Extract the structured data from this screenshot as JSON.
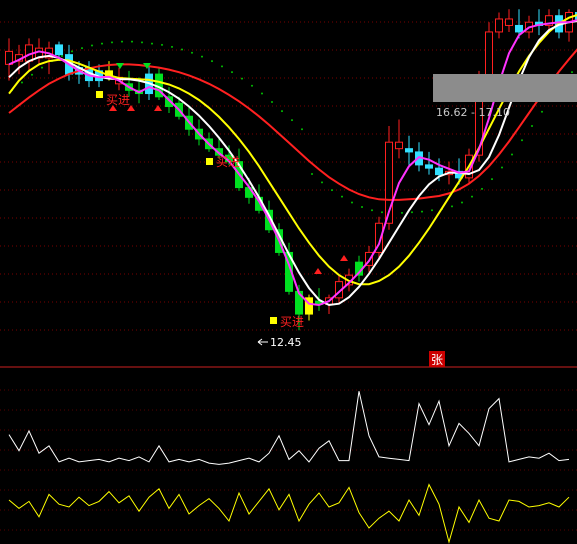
{
  "chart_data": {
    "type": "line",
    "background": "#000000",
    "grid": true,
    "annotations": {
      "buy_label": "买进",
      "low_price": "12.45",
      "range_label": "16.62 - 17.10",
      "zhang_label": "张"
    },
    "candles": [
      {
        "o": 16.55,
        "h": 16.95,
        "l": 16.3,
        "c": 16.75,
        "color": "red"
      },
      {
        "o": 16.7,
        "h": 16.85,
        "l": 16.4,
        "c": 16.6,
        "color": "red"
      },
      {
        "o": 16.6,
        "h": 16.95,
        "l": 16.45,
        "c": 16.85,
        "color": "red"
      },
      {
        "o": 16.8,
        "h": 16.95,
        "l": 16.55,
        "c": 16.65,
        "color": "red"
      },
      {
        "o": 16.65,
        "h": 16.9,
        "l": 16.4,
        "c": 16.8,
        "color": "red"
      },
      {
        "o": 16.85,
        "h": 16.9,
        "l": 16.65,
        "c": 16.7,
        "color": "cyan"
      },
      {
        "o": 16.7,
        "h": 16.85,
        "l": 16.3,
        "c": 16.4,
        "color": "cyan"
      },
      {
        "o": 16.4,
        "h": 16.6,
        "l": 16.25,
        "c": 16.5,
        "color": "cyan"
      },
      {
        "o": 16.5,
        "h": 16.6,
        "l": 16.2,
        "c": 16.3,
        "color": "cyan"
      },
      {
        "o": 16.3,
        "h": 16.55,
        "l": 16.2,
        "c": 16.45,
        "color": "cyan"
      },
      {
        "o": 16.45,
        "h": 16.6,
        "l": 16.3,
        "c": 16.35,
        "color": "yellow"
      },
      {
        "o": 16.35,
        "h": 16.5,
        "l": 16.15,
        "c": 16.25,
        "color": "red"
      },
      {
        "o": 16.25,
        "h": 16.45,
        "l": 16.05,
        "c": 16.15,
        "color": "green"
      },
      {
        "o": 16.15,
        "h": 16.35,
        "l": 15.95,
        "c": 16.1,
        "color": "green"
      },
      {
        "o": 16.1,
        "h": 16.55,
        "l": 16.0,
        "c": 16.4,
        "color": "cyan"
      },
      {
        "o": 16.4,
        "h": 16.5,
        "l": 16.0,
        "c": 16.05,
        "color": "green"
      },
      {
        "o": 16.05,
        "h": 16.2,
        "l": 15.8,
        "c": 15.9,
        "color": "green"
      },
      {
        "o": 15.95,
        "h": 16.05,
        "l": 15.7,
        "c": 15.75,
        "color": "green"
      },
      {
        "o": 15.75,
        "h": 15.9,
        "l": 15.45,
        "c": 15.55,
        "color": "green"
      },
      {
        "o": 15.55,
        "h": 15.7,
        "l": 15.3,
        "c": 15.4,
        "color": "green"
      },
      {
        "o": 15.4,
        "h": 15.5,
        "l": 15.2,
        "c": 15.25,
        "color": "green"
      },
      {
        "o": 15.25,
        "h": 15.4,
        "l": 15.1,
        "c": 15.15,
        "color": "green"
      },
      {
        "o": 15.15,
        "h": 15.3,
        "l": 15.0,
        "c": 15.05,
        "color": "green"
      },
      {
        "o": 15.05,
        "h": 15.25,
        "l": 14.6,
        "c": 14.65,
        "color": "green"
      },
      {
        "o": 14.65,
        "h": 14.8,
        "l": 14.4,
        "c": 14.5,
        "color": "green"
      },
      {
        "o": 14.5,
        "h": 14.7,
        "l": 14.25,
        "c": 14.3,
        "color": "green"
      },
      {
        "o": 14.3,
        "h": 14.45,
        "l": 13.95,
        "c": 14.0,
        "color": "green"
      },
      {
        "o": 14.0,
        "h": 14.1,
        "l": 13.6,
        "c": 13.65,
        "color": "green"
      },
      {
        "o": 13.65,
        "h": 13.8,
        "l": 13.0,
        "c": 13.05,
        "color": "green"
      },
      {
        "o": 13.05,
        "h": 13.15,
        "l": 12.45,
        "c": 12.7,
        "color": "green"
      },
      {
        "o": 12.7,
        "h": 13.0,
        "l": 12.6,
        "c": 12.95,
        "color": "yellow"
      },
      {
        "o": 12.9,
        "h": 13.1,
        "l": 12.75,
        "c": 12.85,
        "color": "green"
      },
      {
        "o": 12.85,
        "h": 13.0,
        "l": 12.7,
        "c": 12.95,
        "color": "red"
      },
      {
        "o": 12.95,
        "h": 13.3,
        "l": 12.85,
        "c": 13.2,
        "color": "red"
      },
      {
        "o": 13.15,
        "h": 13.4,
        "l": 13.05,
        "c": 13.3,
        "color": "red"
      },
      {
        "o": 13.3,
        "h": 13.6,
        "l": 13.2,
        "c": 13.5,
        "color": "green"
      },
      {
        "o": 13.45,
        "h": 13.75,
        "l": 13.35,
        "c": 13.65,
        "color": "red"
      },
      {
        "o": 13.65,
        "h": 14.2,
        "l": 13.55,
        "c": 14.1,
        "color": "red"
      },
      {
        "o": 14.1,
        "h": 15.6,
        "l": 14.0,
        "c": 15.35,
        "color": "red"
      },
      {
        "o": 15.35,
        "h": 15.7,
        "l": 15.1,
        "c": 15.25,
        "color": "red"
      },
      {
        "o": 15.25,
        "h": 15.45,
        "l": 15.0,
        "c": 15.2,
        "color": "cyan"
      },
      {
        "o": 15.2,
        "h": 15.35,
        "l": 14.9,
        "c": 15.0,
        "color": "cyan"
      },
      {
        "o": 15.0,
        "h": 15.2,
        "l": 14.85,
        "c": 14.95,
        "color": "cyan"
      },
      {
        "o": 14.95,
        "h": 15.1,
        "l": 14.75,
        "c": 14.85,
        "color": "cyan"
      },
      {
        "o": 14.85,
        "h": 15.05,
        "l": 14.7,
        "c": 14.9,
        "color": "red"
      },
      {
        "o": 14.9,
        "h": 15.1,
        "l": 14.7,
        "c": 14.8,
        "color": "cyan"
      },
      {
        "o": 14.8,
        "h": 15.25,
        "l": 14.7,
        "c": 15.15,
        "color": "red"
      },
      {
        "o": 15.15,
        "h": 16.45,
        "l": 15.05,
        "c": 16.3,
        "color": "red"
      },
      {
        "o": 16.3,
        "h": 17.2,
        "l": 16.2,
        "c": 17.05,
        "color": "red"
      },
      {
        "o": 17.05,
        "h": 17.35,
        "l": 16.95,
        "c": 17.25,
        "color": "red"
      },
      {
        "o": 17.25,
        "h": 17.4,
        "l": 17.05,
        "c": 17.15,
        "color": "red"
      },
      {
        "o": 17.15,
        "h": 17.4,
        "l": 16.95,
        "c": 17.05,
        "color": "cyan"
      },
      {
        "o": 17.05,
        "h": 17.3,
        "l": 16.95,
        "c": 17.2,
        "color": "red"
      },
      {
        "o": 17.2,
        "h": 17.4,
        "l": 17.0,
        "c": 17.15,
        "color": "cyan"
      },
      {
        "o": 17.15,
        "h": 17.4,
        "l": 17.05,
        "c": 17.3,
        "color": "red"
      },
      {
        "o": 17.3,
        "h": 17.4,
        "l": 16.95,
        "c": 17.05,
        "color": "cyan"
      },
      {
        "o": 17.05,
        "h": 17.4,
        "l": 16.9,
        "c": 17.35,
        "color": "red"
      },
      {
        "o": 17.35,
        "h": 17.4,
        "l": 17.1,
        "c": 17.25,
        "color": "cyan"
      }
    ],
    "lines": [
      {
        "color": "#ff2020",
        "values": [
          15.8,
          15.92,
          16.04,
          16.15,
          16.25,
          16.33,
          16.4,
          16.45,
          16.49,
          16.52,
          16.54,
          16.55,
          16.55,
          16.54,
          16.52,
          16.5,
          16.47,
          16.43,
          16.38,
          16.32,
          16.25,
          16.17,
          16.08,
          15.98,
          15.87,
          15.75,
          15.62,
          15.48,
          15.34,
          15.2,
          15.06,
          14.93,
          14.81,
          14.71,
          14.62,
          14.55,
          14.5,
          14.47,
          14.46,
          14.46,
          14.47,
          14.48,
          14.5,
          14.52,
          14.56,
          14.62,
          14.71,
          14.83,
          14.98,
          15.16,
          15.36,
          15.58,
          15.8,
          16.02,
          16.23,
          16.44,
          16.63,
          16.81,
          16.96
        ]
      },
      {
        "color": "#ffff00",
        "values": [
          16.1,
          16.3,
          16.45,
          16.55,
          16.6,
          16.62,
          16.61,
          16.56,
          16.5,
          16.44,
          16.38,
          16.34,
          16.33,
          16.32,
          16.31,
          16.28,
          16.24,
          16.18,
          16.1,
          16.0,
          15.88,
          15.74,
          15.58,
          15.4,
          15.2,
          14.98,
          14.74,
          14.5,
          14.26,
          14.02,
          13.8,
          13.6,
          13.43,
          13.3,
          13.21,
          13.16,
          13.16,
          13.21,
          13.3,
          13.43,
          13.6,
          13.8,
          14.02,
          14.26,
          14.5,
          14.74,
          14.98,
          15.26,
          15.56,
          15.86,
          16.16,
          16.44,
          16.68,
          16.88,
          17.05,
          17.18,
          17.27,
          17.32,
          17.34
        ]
      },
      {
        "color": "#ffffff",
        "values": [
          16.35,
          16.5,
          16.6,
          16.66,
          16.68,
          16.65,
          16.58,
          16.5,
          16.42,
          16.36,
          16.33,
          16.32,
          16.32,
          16.3,
          16.26,
          16.2,
          16.12,
          16.02,
          15.9,
          15.76,
          15.6,
          15.42,
          15.22,
          15.0,
          14.76,
          14.5,
          14.22,
          13.92,
          13.62,
          13.34,
          13.1,
          12.92,
          12.84,
          12.86,
          12.96,
          13.12,
          13.32,
          13.55,
          13.8,
          14.05,
          14.3,
          14.52,
          14.7,
          14.82,
          14.88,
          14.88,
          14.86,
          14.92,
          15.12,
          15.46,
          15.88,
          16.3,
          16.66,
          16.92,
          17.08,
          17.16,
          17.2,
          17.22,
          17.24
        ]
      },
      {
        "color": "#ff33ff",
        "values": [
          16.55,
          16.62,
          16.7,
          16.75,
          16.72,
          16.65,
          16.55,
          16.45,
          16.38,
          16.35,
          16.36,
          16.3,
          16.2,
          16.12,
          16.2,
          16.15,
          16.0,
          15.85,
          15.66,
          15.48,
          15.32,
          15.18,
          15.06,
          14.86,
          14.66,
          14.44,
          14.16,
          13.84,
          13.46,
          13.02,
          12.86,
          12.84,
          12.9,
          13.04,
          13.18,
          13.34,
          13.52,
          13.78,
          14.28,
          14.72,
          14.98,
          15.12,
          15.08,
          15.0,
          14.94,
          14.88,
          14.9,
          15.24,
          15.72,
          16.26,
          16.72,
          17.0,
          17.12,
          17.16,
          17.18,
          17.2,
          17.2,
          17.24,
          17.26
        ]
      }
    ],
    "volume": [
      3.5,
      2.2,
      3.8,
      2.0,
      2.6,
      1.3,
      1.6,
      1.3,
      1.4,
      1.5,
      1.3,
      1.6,
      1.4,
      1.7,
      1.3,
      2.6,
      1.3,
      1.5,
      1.3,
      1.5,
      1.2,
      1.1,
      1.2,
      1.4,
      1.6,
      1.3,
      2.0,
      3.4,
      1.5,
      2.2,
      1.3,
      2.4,
      3.0,
      1.4,
      1.4,
      7.0,
      3.4,
      1.7,
      1.6,
      1.5,
      1.4,
      6.0,
      4.3,
      6.2,
      2.6,
      4.4,
      3.6,
      2.6,
      5.6,
      6.4,
      1.3,
      1.5,
      1.7,
      1.6,
      2.0,
      1.4,
      1.5
    ],
    "oscillator": [
      0.0,
      -0.6,
      -0.1,
      -1.2,
      0.4,
      -0.3,
      -0.5,
      0.2,
      -0.4,
      -0.1,
      0.6,
      -0.2,
      0.3,
      -0.8,
      0.2,
      0.8,
      -0.6,
      0.4,
      -1.0,
      -0.4,
      0.1,
      -0.6,
      -1.5,
      0.5,
      -1.0,
      -0.1,
      0.8,
      -0.7,
      0.4,
      -1.5,
      -0.3,
      0.5,
      -0.5,
      -0.2,
      0.9,
      -0.9,
      -2.0,
      -1.3,
      -0.8,
      -1.5,
      0.0,
      -1.1,
      1.1,
      -0.3,
      -3.0,
      -0.5,
      -1.6,
      0.0,
      -1.3,
      -1.5,
      0.0,
      -0.1,
      -0.5,
      -0.4,
      -0.2,
      -0.5,
      0.2
    ]
  }
}
